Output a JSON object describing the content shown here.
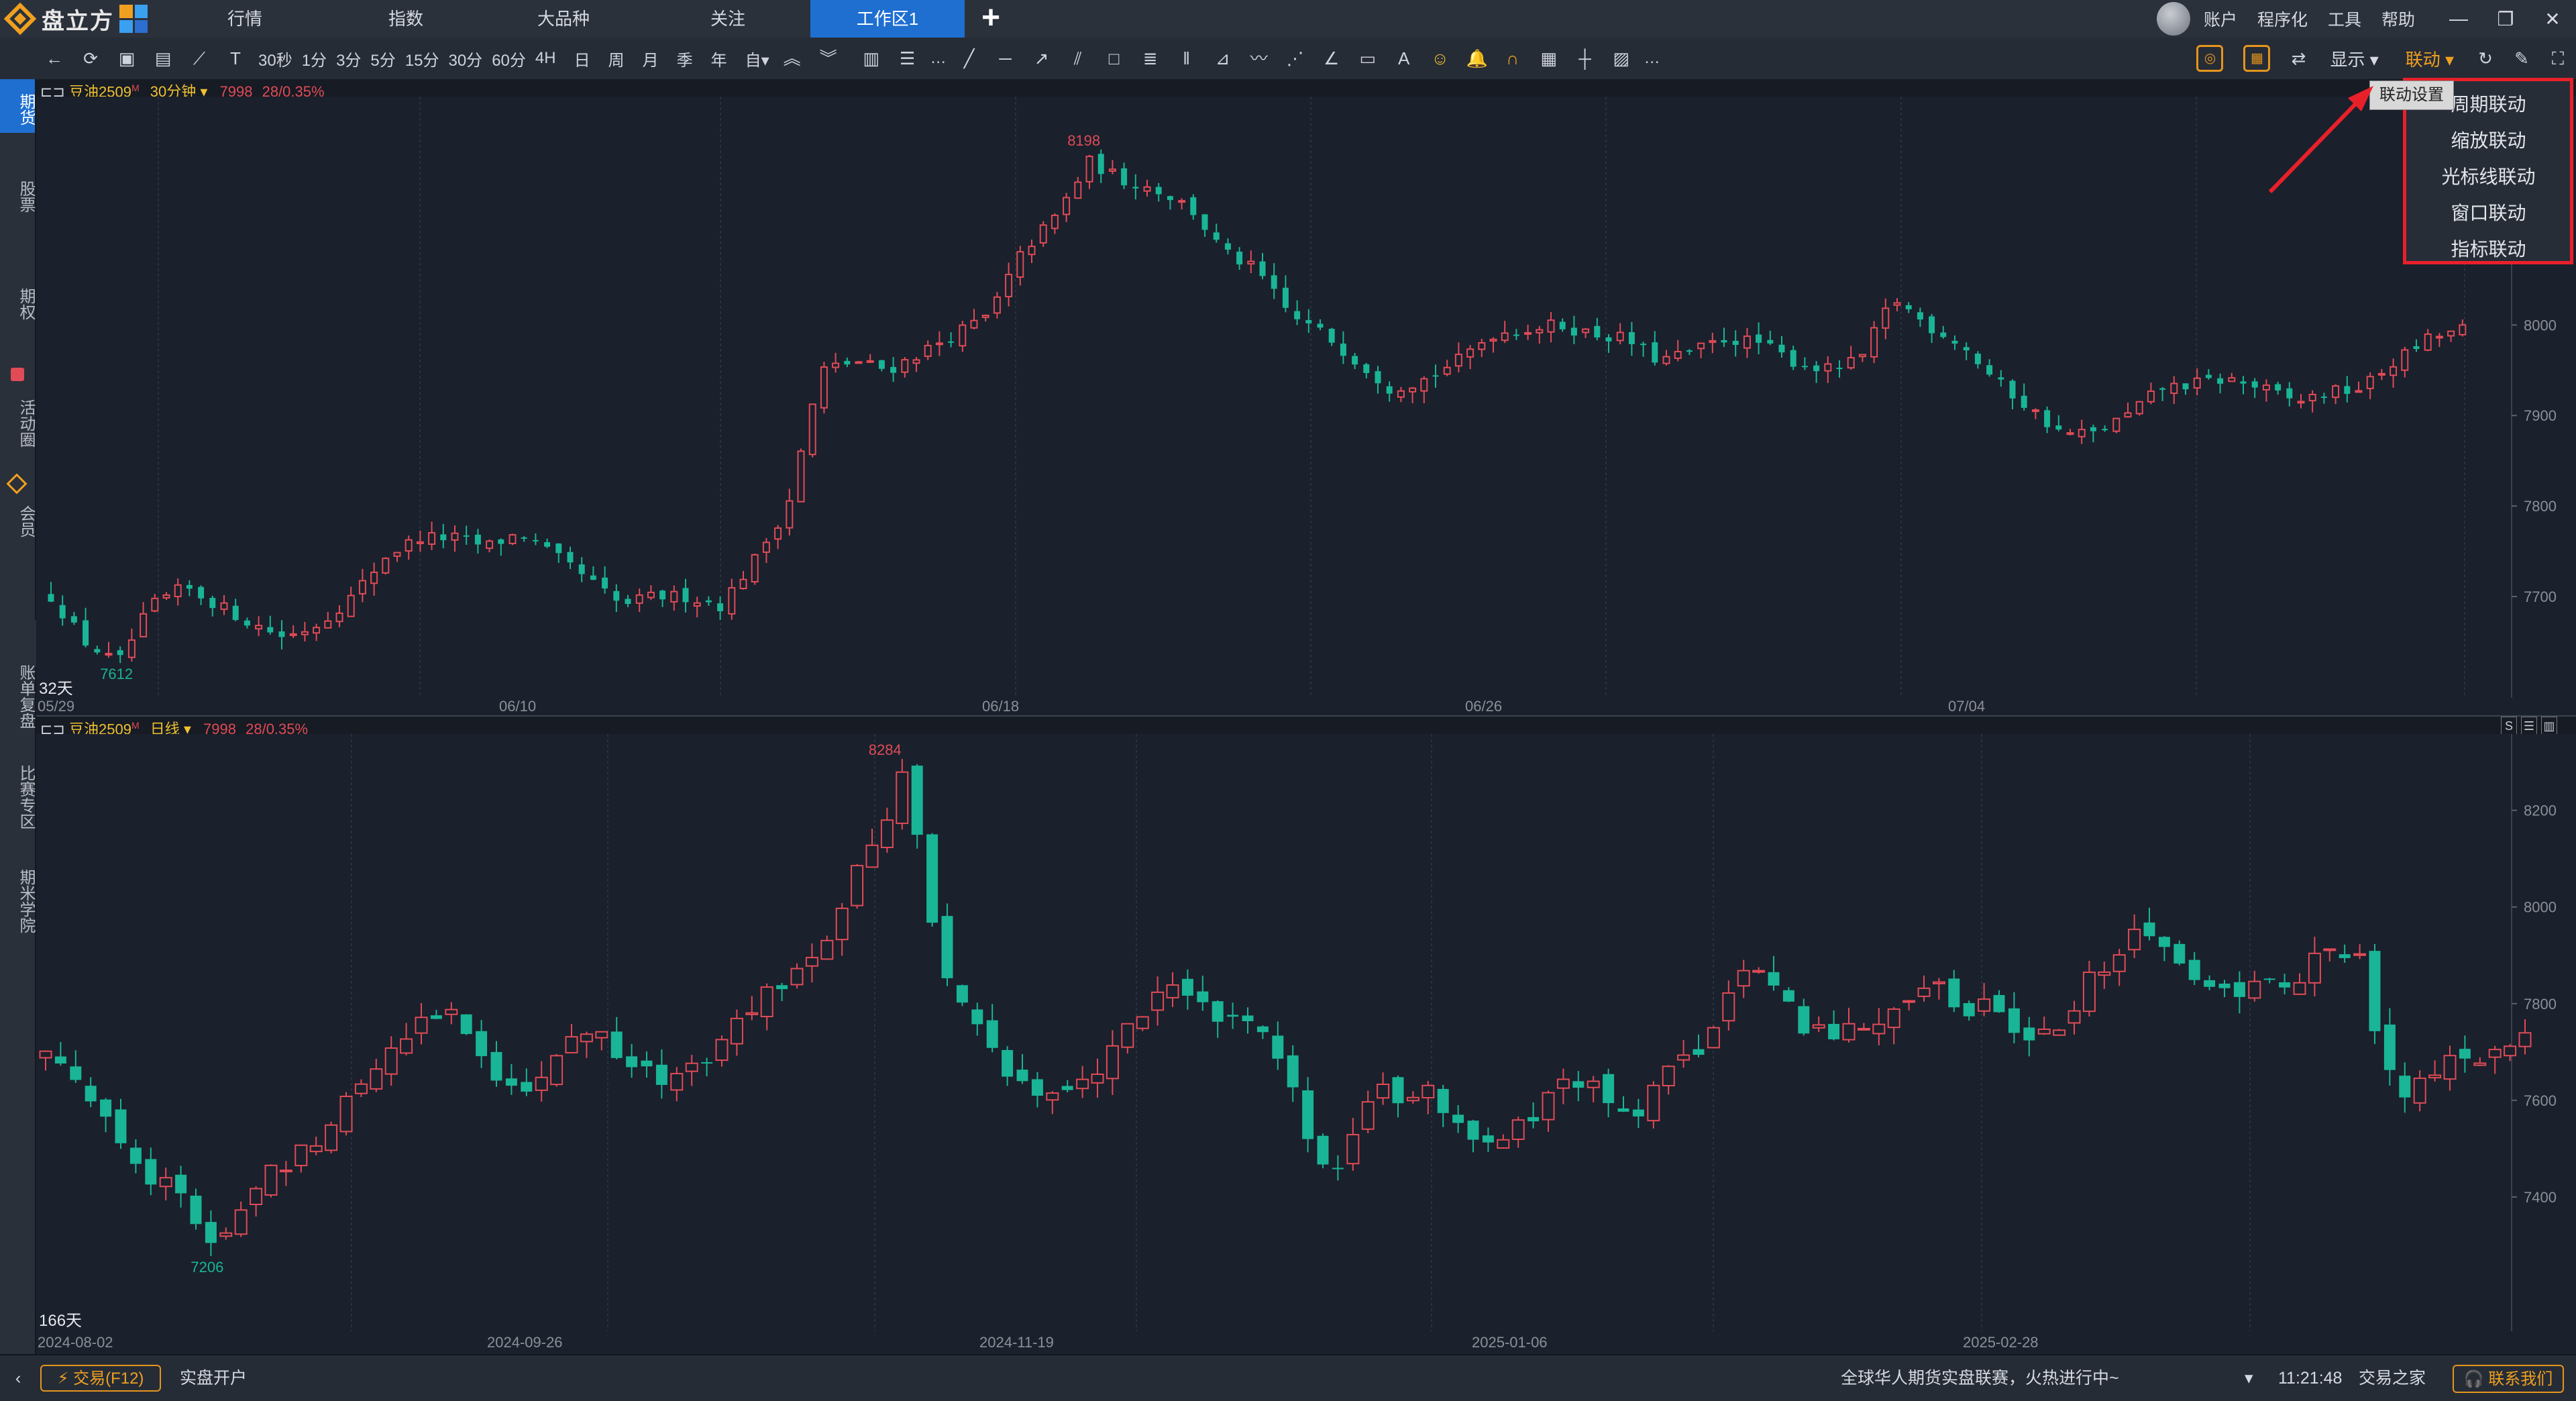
{
  "app": {
    "name": "盘立方"
  },
  "nav_tabs": [
    {
      "label": "行情"
    },
    {
      "label": "指数"
    },
    {
      "label": "大品种"
    },
    {
      "label": "关注"
    },
    {
      "label": "工作区1"
    }
  ],
  "window_links": [
    "账户",
    "程序化",
    "工具",
    "帮助"
  ],
  "window_controls": [
    "—",
    "❐",
    "✕"
  ],
  "toolbar": {
    "periods": [
      "30秒",
      "1分",
      "3分",
      "5分",
      "15分",
      "30分",
      "60分",
      "4H",
      "日",
      "周",
      "月",
      "季",
      "年",
      "自▾"
    ],
    "more": "…",
    "more2": "…",
    "show_label": "显示 ▾",
    "link_label": "联动 ▾"
  },
  "sidebar": {
    "items": [
      "期货",
      "股票",
      "期权",
      "活动圈",
      "会员",
      "账单复盘",
      "比赛专区",
      "期米学院"
    ]
  },
  "panel_top": {
    "symbol": "豆油2509",
    "super": "M",
    "period": "30分钟 ▾",
    "price": "7998",
    "change": "28/0.35%",
    "high_label": "8198",
    "low_label": "7612",
    "days": "32天",
    "x_ticks": [
      "05/29",
      "06/10",
      "06/18",
      "06/26",
      "07/04"
    ],
    "y_ticks": [
      "8000",
      "7900",
      "7800",
      "7700"
    ]
  },
  "panel_bottom": {
    "symbol": "豆油2509",
    "super": "M",
    "period": "日线 ▾",
    "price": "7998",
    "change": "28/0.35%",
    "high_label": "8284",
    "low_label": "7206",
    "days": "166天",
    "x_ticks": [
      "2024-08-02",
      "2024-09-26",
      "2024-11-19",
      "2025-01-06",
      "2025-02-28"
    ],
    "y_ticks": [
      "8200",
      "8000",
      "7800",
      "7600",
      "7400"
    ],
    "corner_buttons": [
      "S",
      "☰",
      "▥"
    ]
  },
  "link_menu": {
    "tooltip": "联动设置",
    "items": [
      "周期联动",
      "缩放联动",
      "光标线联动",
      "窗口联动",
      "指标联动"
    ]
  },
  "statusbar": {
    "trade": "⚡ 交易(F12)",
    "open_account": "实盘开户",
    "ticker": "全球华人期货实盘联赛，火热进行中~",
    "time": "11:21:48",
    "brand": "交易之家",
    "contact": "🎧 联系我们"
  },
  "colors": {
    "up": "#e04b56",
    "down": "#19b596",
    "accent": "#f0a020",
    "active_tab": "#1f6fd1",
    "highlight_border": "#e8202a"
  },
  "chart_data": [
    {
      "type": "candlestick",
      "title": "豆油2509 30分钟",
      "y_ticks": [
        8000,
        7900,
        7800,
        7700
      ],
      "ylim": [
        7600,
        8230
      ],
      "x_ticks": [
        "05/29",
        "06/10",
        "06/18",
        "06/26",
        "07/04"
      ],
      "close_path": [
        7700,
        7650,
        7625,
        7690,
        7710,
        7690,
        7670,
        7655,
        7670,
        7700,
        7745,
        7765,
        7765,
        7755,
        7770,
        7745,
        7720,
        7690,
        7700,
        7700,
        7690,
        7740,
        7800,
        7950,
        7960,
        7950,
        7970,
        7990,
        8010,
        8080,
        8120,
        8180,
        8160,
        8150,
        8130,
        8080,
        8060,
        8010,
        7990,
        7960,
        7930,
        7940,
        7960,
        7990,
        7995,
        8000,
        7990,
        7985,
        7960,
        7970,
        7985,
        7980,
        7960,
        7950,
        7960,
        8030,
        8000,
        7980,
        7940,
        7910,
        7880,
        7880,
        7900,
        7930,
        7935,
        7940,
        7930,
        7915,
        7925,
        7930,
        7960,
        7985,
        7995
      ]
    },
    {
      "type": "candlestick",
      "title": "豆油2509 日线",
      "y_ticks": [
        8200,
        8000,
        7800,
        7600,
        7400
      ],
      "ylim": [
        7150,
        8330
      ],
      "x_ticks": [
        "2024-08-02",
        "2024-09-26",
        "2024-11-19",
        "2025-01-06",
        "2025-02-28"
      ],
      "close_path": [
        7700,
        7640,
        7560,
        7450,
        7400,
        7300,
        7380,
        7460,
        7510,
        7600,
        7680,
        7750,
        7800,
        7700,
        7620,
        7660,
        7740,
        7720,
        7650,
        7630,
        7700,
        7790,
        7830,
        7860,
        8000,
        8120,
        8280,
        7900,
        7760,
        7650,
        7620,
        7640,
        7660,
        7790,
        7820,
        7790,
        7780,
        7720,
        7560,
        7420,
        7600,
        7620,
        7620,
        7540,
        7510,
        7560,
        7640,
        7610,
        7570,
        7640,
        7700,
        7860,
        7840,
        7770,
        7730,
        7760,
        7790,
        7830,
        7800,
        7790,
        7740,
        7770,
        7860,
        7930,
        7930,
        7870,
        7810,
        7840,
        7850,
        7900,
        7890,
        7620,
        7640,
        7680,
        7700,
        7720
      ]
    }
  ]
}
